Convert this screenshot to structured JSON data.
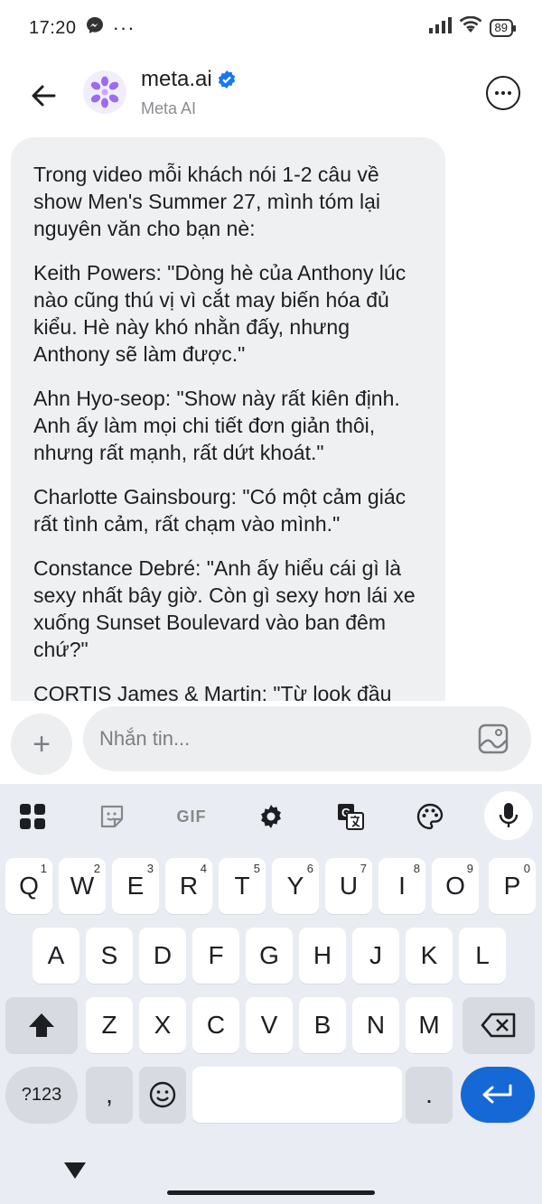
{
  "status_bar": {
    "time": "17:20",
    "battery": "89"
  },
  "header": {
    "title": "meta.ai",
    "subtitle": "Meta AI"
  },
  "message": {
    "paragraphs": [
      "Trong video mỗi khách nói 1-2 câu về show Men's Summer 27, mình tóm lại nguyên văn cho bạn nè:",
      "Keith Powers: \"Dòng hè của Anthony lúc nào cũng thú vị vì cắt may biến hóa đủ kiểu. Hè này khó nhằn đấy, nhưng Anthony sẽ làm được.\"",
      "Ahn Hyo-seop: \"Show này rất kiên định. Anh ấy làm mọi chi tiết đơn giản thôi, nhưng rất mạnh, rất dứt khoát.\"",
      "Charlotte Gainsbourg: \"Có một cảm giác rất tình cảm, rất chạm vào mình.\"",
      "Constance Debré: \"Anh ấy hiểu cái gì là sexy nhất bây giờ. Còn gì sexy hơn lái xe xuống Sunset Boulevard vào ban đêm chứ?\"",
      "CORTIS James & Martin: \"Từ look đầu"
    ]
  },
  "composer": {
    "placeholder": "Nhắn tin...",
    "plus": "+"
  },
  "keyboard": {
    "toolbar": {
      "gif": "GIF"
    },
    "row1": [
      {
        "k": "Q",
        "h": "1"
      },
      {
        "k": "W",
        "h": "2"
      },
      {
        "k": "E",
        "h": "3"
      },
      {
        "k": "R",
        "h": "4"
      },
      {
        "k": "T",
        "h": "5"
      },
      {
        "k": "Y",
        "h": "6"
      },
      {
        "k": "U",
        "h": "7"
      },
      {
        "k": "I",
        "h": "8"
      },
      {
        "k": "O",
        "h": "9"
      },
      {
        "k": "P",
        "h": "0"
      }
    ],
    "row2": [
      "A",
      "S",
      "D",
      "F",
      "G",
      "H",
      "J",
      "K",
      "L"
    ],
    "row3": [
      "Z",
      "X",
      "C",
      "V",
      "B",
      "N",
      "M"
    ],
    "num_key": "?123",
    "comma": ",",
    "period": "."
  },
  "colors": {
    "accent": "#1668d6",
    "bubble": "#eff0f2",
    "keyboard_bg": "#e9edf3"
  }
}
